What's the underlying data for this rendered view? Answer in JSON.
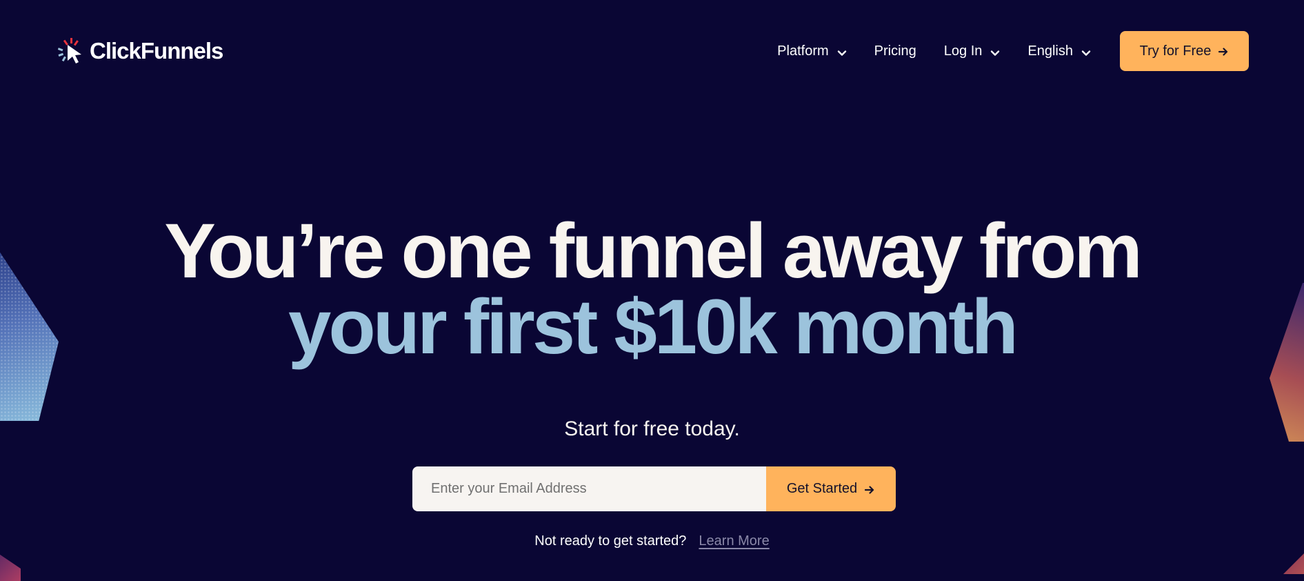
{
  "brand": {
    "name": "ClickFunnels",
    "colors": {
      "background": "#0a0634",
      "accent": "#ffb35c",
      "headline": "#f8f4ef",
      "headline_highlight": "#9cc3dc",
      "logo_red": "#e8323c"
    }
  },
  "nav": {
    "items": [
      {
        "label": "Platform",
        "icon": "chevron-down-icon"
      },
      {
        "label": "Pricing"
      },
      {
        "label": "Log In",
        "icon": "chevron-down-icon"
      },
      {
        "label": "English",
        "icon": "chevron-down-icon"
      }
    ],
    "cta_label": "Try for Free",
    "cta_icon": "arrow-right-icon"
  },
  "hero": {
    "line1": "You’re one funnel away from",
    "line2": "your first $10k month",
    "subhead": "Start for free today."
  },
  "form": {
    "email_placeholder": "Enter your Email Address",
    "submit_label": "Get Started",
    "submit_icon": "arrow-right-icon"
  },
  "footer": {
    "prompt": "Not ready to get started?",
    "link_label": "Learn More"
  }
}
